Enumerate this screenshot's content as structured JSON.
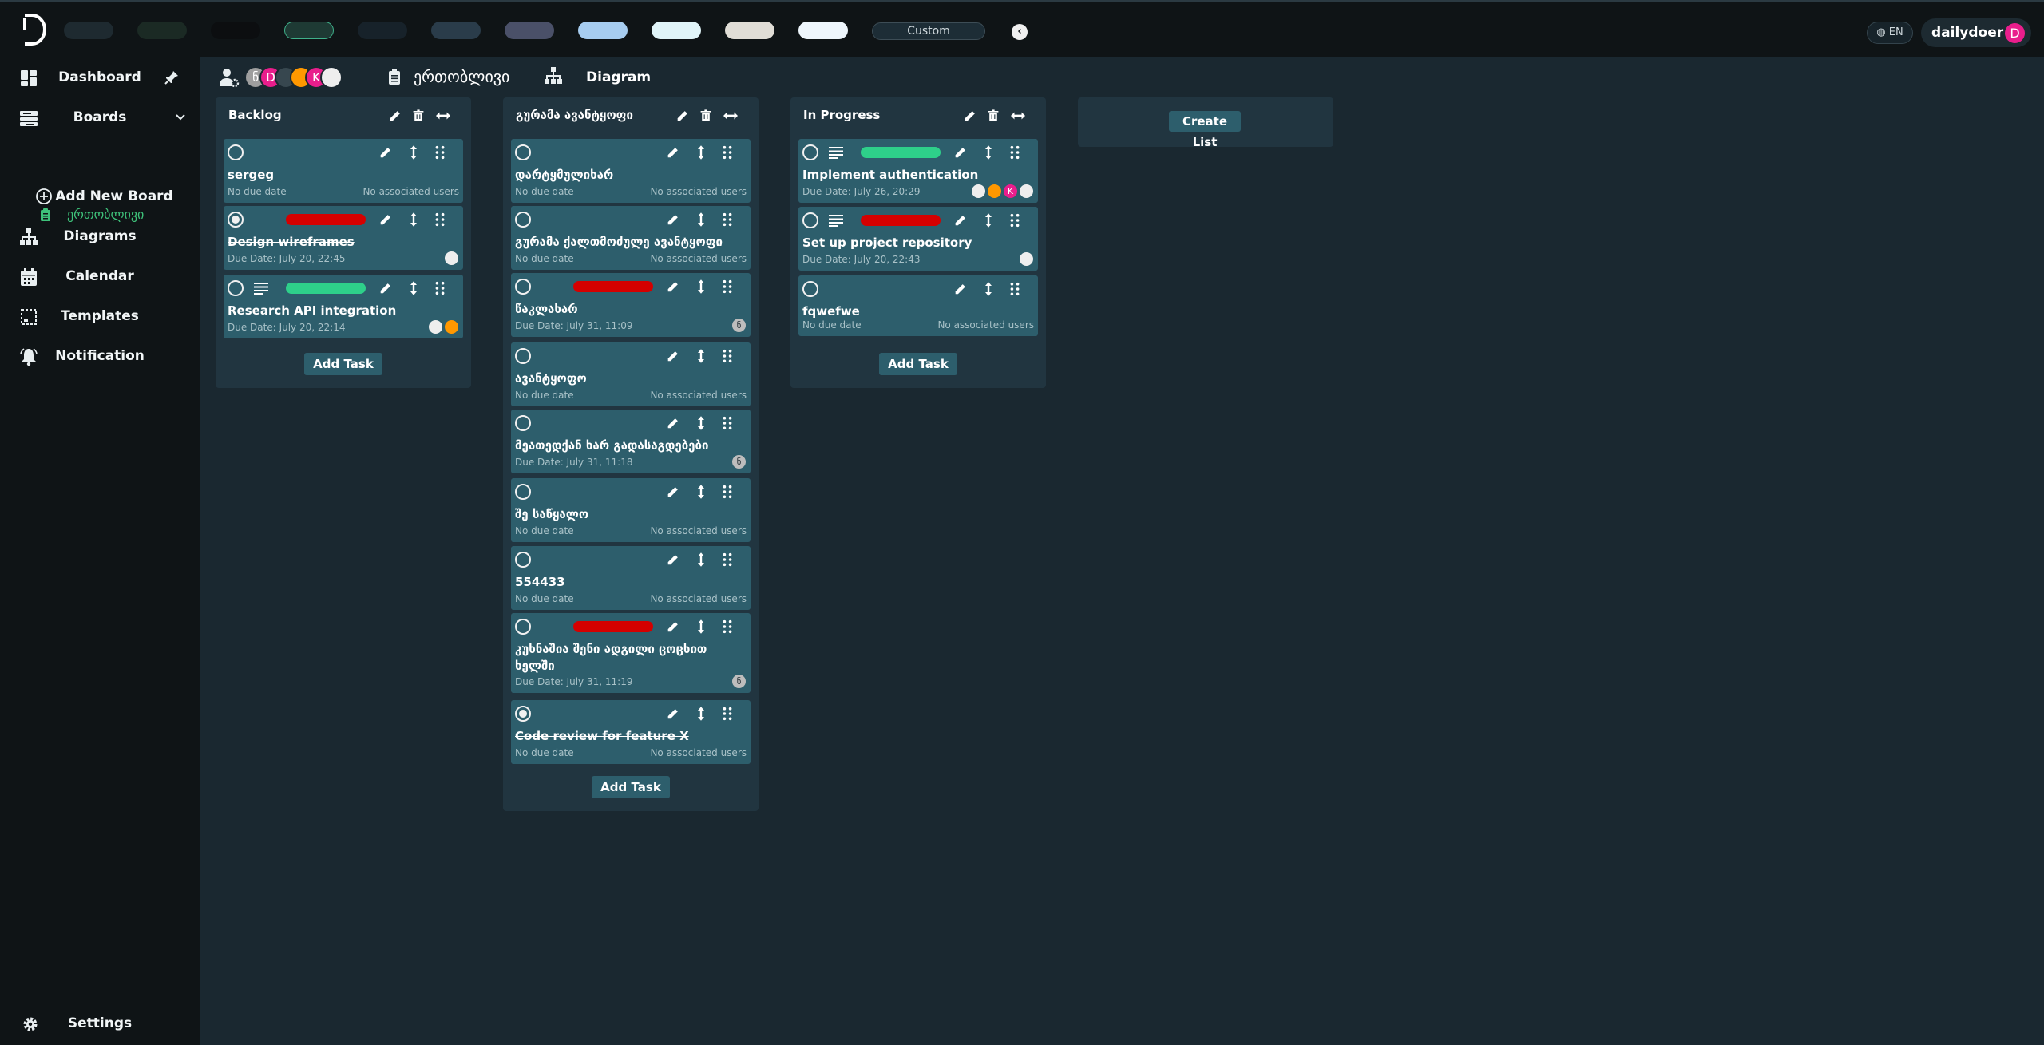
{
  "topbar": {
    "theme_swatches": [
      "#1e2a30",
      "#1b2a24",
      "#0c0e10",
      "#1e3a34",
      "#17222a",
      "#2a3c4a",
      "#4a5068",
      "#a7cdf0",
      "#e0f4f8",
      "#e0ddd6",
      "#eef6fc"
    ],
    "custom_label": "Custom",
    "lang_label": "EN",
    "username": "dailydoer",
    "user_initial": "D"
  },
  "sidebar": {
    "dashboard": "Dashboard",
    "boards": "Boards",
    "board_item": "ერთობლივი",
    "add_board": "Add New Board",
    "diagrams": "Diagrams",
    "calendar": "Calendar",
    "templates": "Templates",
    "notification": "Notification",
    "settings": "Settings"
  },
  "board": {
    "title": "ერთობლივი",
    "diagram_label": "Diagram",
    "members": [
      {
        "initial": "ნ",
        "color": "#9e9e9e"
      },
      {
        "initial": "D",
        "color": "#e91e8c"
      },
      {
        "initial": "",
        "color": "#37474f"
      },
      {
        "initial": "",
        "color": "#ff9800"
      },
      {
        "initial": "K",
        "color": "#e91e8c"
      },
      {
        "initial": "",
        "color": "#eeeeee"
      }
    ]
  },
  "lists": [
    {
      "title": "Backlog",
      "add_task": "Add Task",
      "cards": [
        {
          "title": "sergeg",
          "date": "No due date",
          "users": "No associated users",
          "done": false,
          "label": "",
          "desc": false,
          "avatars": []
        },
        {
          "title": "Design wireframes",
          "date": "Due Date: July 20, 22:45",
          "users": "",
          "done": true,
          "label": "#d50000",
          "desc": false,
          "avatars": [
            {
              "i": "",
              "c": "#eeeeee"
            }
          ]
        },
        {
          "title": "Research API integration",
          "date": "Due Date: July 20, 22:14",
          "users": "",
          "done": false,
          "label": "#2ed08a",
          "desc": true,
          "avatars": [
            {
              "i": "",
              "c": "#eeeeee"
            },
            {
              "i": "",
              "c": "#ff9800"
            }
          ]
        }
      ]
    },
    {
      "title": "გურამა ავანტყოფი",
      "add_task": "Add Task",
      "cards": [
        {
          "title": "დარტყმულიხარ",
          "date": "No due date",
          "users": "No associated users",
          "done": false,
          "label": "",
          "desc": false,
          "avatars": []
        },
        {
          "title": "გურამა ქალთმოძულე ავანტყოფი",
          "date": "No due date",
          "users": "No associated users",
          "done": false,
          "label": "",
          "desc": false,
          "avatars": []
        },
        {
          "title": "წაკლახარ",
          "date": "Due Date: July 31, 11:09",
          "users": "",
          "done": false,
          "label": "#d50000",
          "desc": false,
          "avatars": [
            {
              "i": "ნ",
              "c": "#bdbdbd"
            }
          ]
        },
        {
          "title": "ავანტყოფო",
          "date": "No due date",
          "users": "No associated users",
          "done": false,
          "label": "",
          "desc": false,
          "avatars": []
        },
        {
          "title": "მეათედქან ხარ გადასაგდებები",
          "date": "Due Date: July 31, 11:18",
          "users": "",
          "done": false,
          "label": "",
          "desc": false,
          "avatars": [
            {
              "i": "ნ",
              "c": "#bdbdbd"
            }
          ]
        },
        {
          "title": "შე საწყალო",
          "date": "No due date",
          "users": "No associated users",
          "done": false,
          "label": "",
          "desc": false,
          "avatars": []
        },
        {
          "title": "554433",
          "date": "No due date",
          "users": "No associated users",
          "done": false,
          "label": "",
          "desc": false,
          "avatars": []
        },
        {
          "title": "კუხნაშია შენი ადგილი ცოცხით ხელში",
          "date": "Due Date: July 31, 11:19",
          "users": "",
          "done": false,
          "label": "#d50000",
          "desc": false,
          "avatars": [
            {
              "i": "ნ",
              "c": "#bdbdbd"
            }
          ]
        },
        {
          "title": "Code review for feature X",
          "date": "No due date",
          "users": "No associated users",
          "done": true,
          "label": "",
          "desc": false,
          "avatars": []
        }
      ]
    },
    {
      "title": "In Progress",
      "add_task": "Add Task",
      "cards": [
        {
          "title": "Implement authentication",
          "date": "Due Date: July 26, 20:29",
          "users": "",
          "done": false,
          "label": "#2ed08a",
          "desc": true,
          "avatars": [
            {
              "i": "",
              "c": "#eeeeee"
            },
            {
              "i": "",
              "c": "#ff9800"
            },
            {
              "i": "K",
              "c": "#e91e8c"
            },
            {
              "i": "",
              "c": "#eeeeee"
            }
          ]
        },
        {
          "title": "Set up project repository",
          "date": "Due Date: July 20, 22:43",
          "users": "",
          "done": false,
          "label": "#d50000",
          "desc": true,
          "avatars": [
            {
              "i": "",
              "c": "#eeeeee"
            }
          ]
        },
        {
          "title": "fqwefwe",
          "date": "No due date",
          "users": "No associated users",
          "done": false,
          "label": "",
          "desc": false,
          "avatars": []
        }
      ]
    }
  ],
  "create_list": "Create List"
}
